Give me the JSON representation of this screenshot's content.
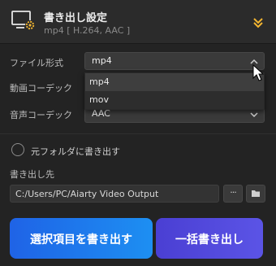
{
  "header": {
    "title": "書き出し設定",
    "subtitle": "mp4 [ H.264, AAC ]",
    "icon": "monitor-gear-icon",
    "accent": "#f2b531"
  },
  "format": {
    "label": "ファイル形式",
    "value": "mp4",
    "options": [
      "mp4",
      "mov"
    ]
  },
  "video_codec": {
    "label": "動画コーデック"
  },
  "audio_codec": {
    "label": "音声コーデック",
    "value": "AAC"
  },
  "export_to_source": {
    "label": "元フォルダに書き出す",
    "checked": false
  },
  "destination": {
    "label": "書き出し先",
    "path": "C:/Users/PC/Aiarty Video Output",
    "more_label": "···"
  },
  "buttons": {
    "export_selected": "選択項目を書き出す",
    "export_all": "一括書き出し"
  },
  "colors": {
    "export_selected": "#1d7cef",
    "export_all": "#5049de"
  }
}
